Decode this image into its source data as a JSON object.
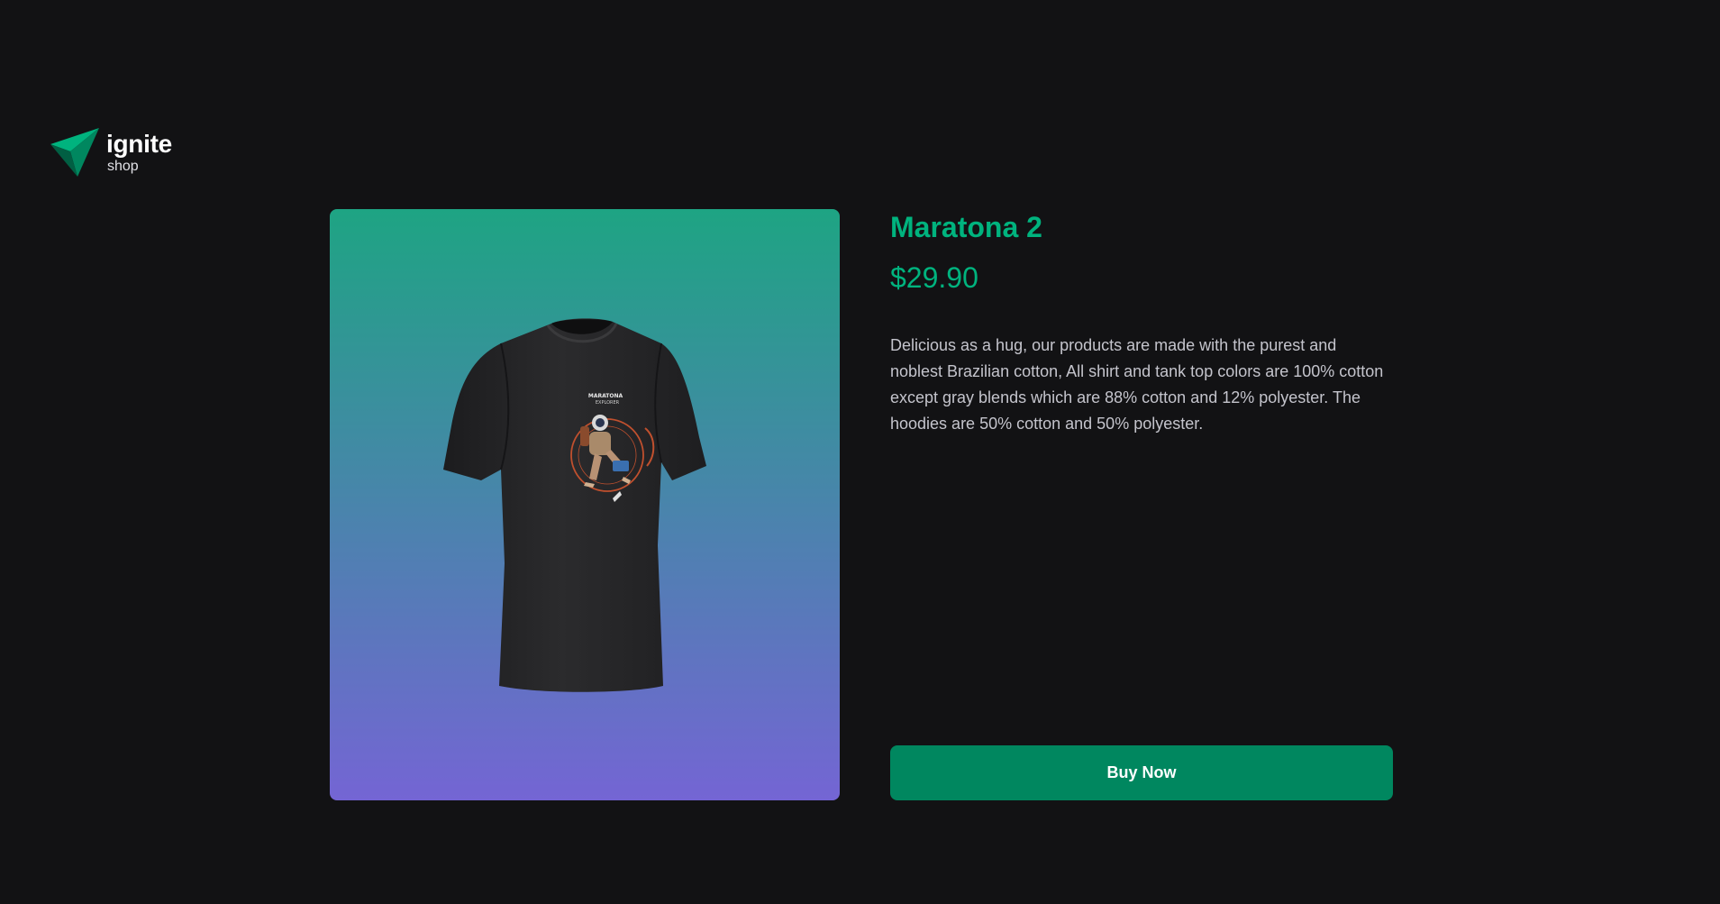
{
  "header": {
    "logo_icon": "ignite-triangle-logo",
    "logo_title": "ignite",
    "logo_subtitle": "shop"
  },
  "product": {
    "image_icon": "t-shirt-image",
    "image_alt": "Maratona Explorer t-shirt",
    "shirt_print_text": [
      "MARATONA",
      "EXPLORER"
    ],
    "name": "Maratona 2",
    "price": "$29.90",
    "description": "Delicious as a hug, our products are made with the purest and noblest Brazilian cotton, All shirt and tank top colors are 100% cotton except gray blends which are 88% cotton and 12% polyester. The hoodies are 50% cotton and 50% polyester.",
    "buy_button_label": "Buy Now"
  },
  "colors": {
    "background": "#121214",
    "accent": "#00b37e",
    "button": "#00875f",
    "image_gradient_top": "#1ea483",
    "image_gradient_bottom": "#7465d4",
    "text": "#c4c4cc"
  }
}
